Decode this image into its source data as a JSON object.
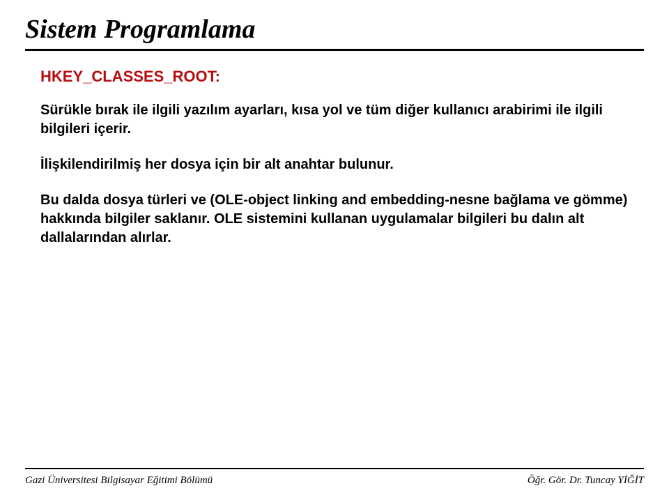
{
  "title": "Sistem Programlama",
  "heading": "HKEY_CLASSES_ROOT:",
  "paragraphs": [
    "Sürükle bırak ile ilgili yazılım ayarları, kısa yol ve tüm diğer kullanıcı arabirimi ile ilgili bilgileri içerir.",
    "İlişkilendirilmiş her dosya için bir alt anahtar bulunur.",
    "Bu dalda dosya türleri ve (OLE-object linking and embedding-nesne bağlama ve gömme) hakkında bilgiler saklanır. OLE sistemini kullanan uygulamalar bilgileri bu dalın alt dallalarından alırlar."
  ],
  "footer": {
    "left": "Gazi Üniversitesi Bilgisayar Eğitimi Bölümü",
    "right": "Öğr. Gör. Dr. Tuncay YİĞİT"
  }
}
